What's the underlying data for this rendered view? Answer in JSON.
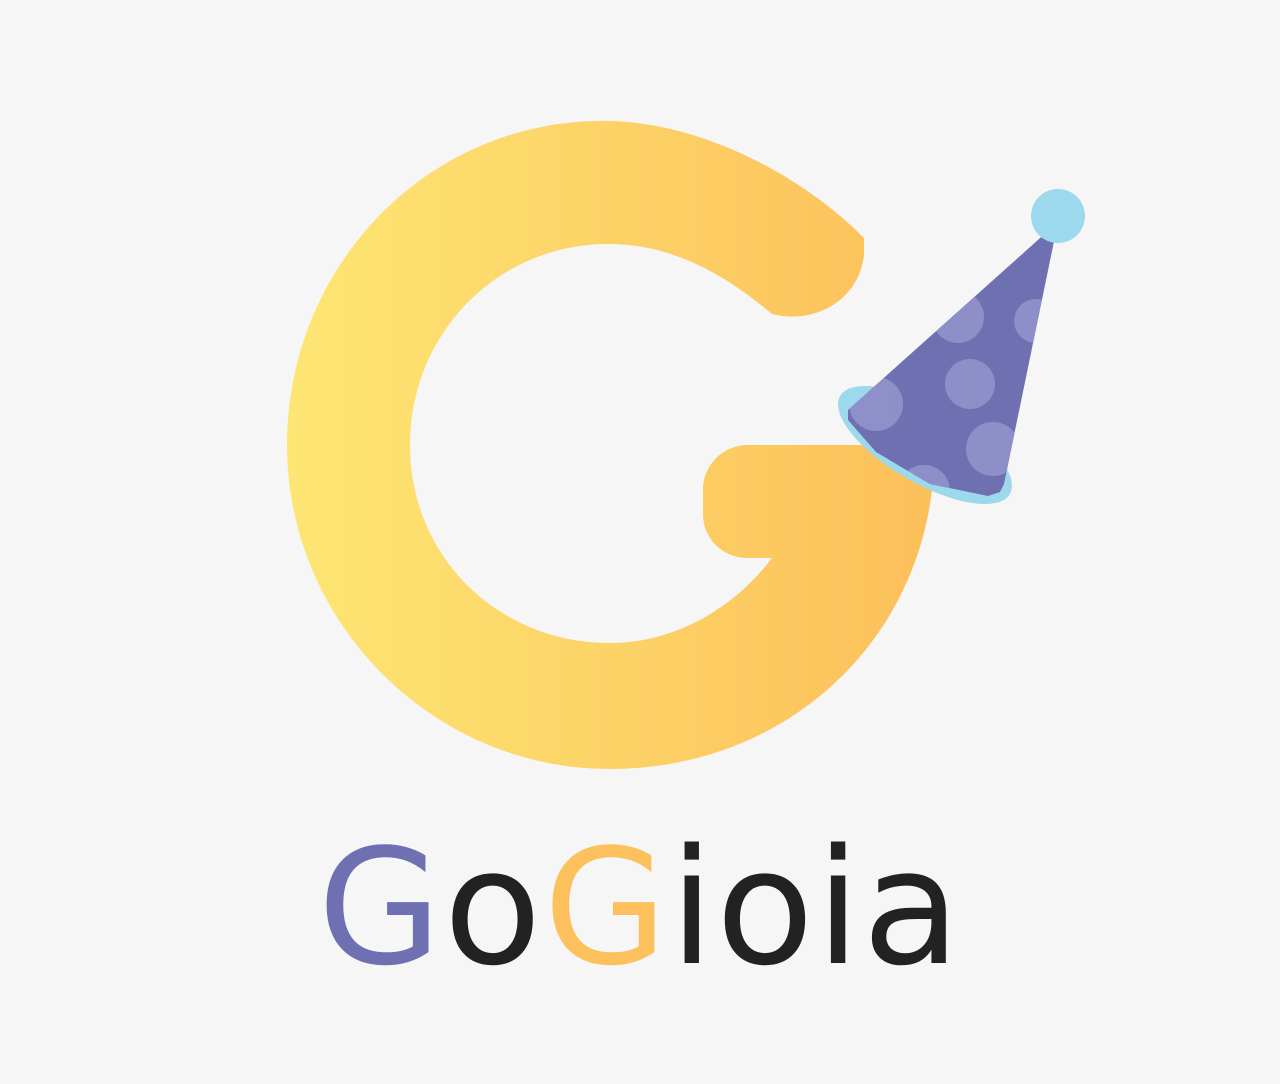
{
  "logo": {
    "mark_icon": "letter-g-with-party-hat-icon",
    "hat_icon": "party-hat-icon",
    "colors": {
      "g_gradient_start": "#fde674",
      "g_gradient_end": "#fcbf5a",
      "hat": "#6f70b2",
      "hat_dots": "#9090c8",
      "hat_brim": "#9cd9ec",
      "pompom": "#9cd9ec",
      "background": "#f6f6f6"
    }
  },
  "wordmark": {
    "parts": [
      {
        "text": "G",
        "color": "#6f70b2"
      },
      {
        "text": "o",
        "color": "#222222"
      },
      {
        "text": "G",
        "color": "#fcc15c"
      },
      {
        "text": "ioia",
        "color": "#222222"
      }
    ]
  }
}
